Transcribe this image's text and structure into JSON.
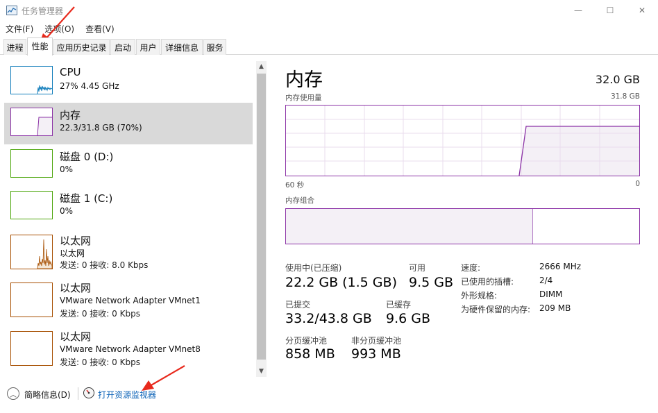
{
  "window": {
    "title": "任务管理器",
    "minimize_glyph": "—",
    "maximize_glyph": "☐",
    "close_glyph": "✕"
  },
  "menu": [
    "文件(F)",
    "选项(O)",
    "查看(V)"
  ],
  "tabs": [
    "进程",
    "性能",
    "应用历史记录",
    "启动",
    "用户",
    "详细信息",
    "服务"
  ],
  "active_tab": "性能",
  "sidebar": {
    "items": [
      {
        "title": "CPU",
        "line1": "27%  4.45 GHz",
        "line2": "",
        "color": "#117dbb"
      },
      {
        "title": "内存",
        "line1": "22.3/31.8 GB (70%)",
        "line2": "",
        "color": "#8b32a6"
      },
      {
        "title": "磁盘 0 (D:)",
        "line1": "0%",
        "line2": "",
        "color": "#4da60c"
      },
      {
        "title": "磁盘 1 (C:)",
        "line1": "0%",
        "line2": "",
        "color": "#4da60c"
      },
      {
        "title": "以太网",
        "line1": "以太网",
        "line2": "发送: 0  接收: 8.0 Kbps",
        "color": "#a74f01"
      },
      {
        "title": "以太网",
        "line1": "VMware Network Adapter VMnet1",
        "line2": "发送: 0  接收: 0 Kbps",
        "color": "#a74f01"
      },
      {
        "title": "以太网",
        "line1": "VMware Network Adapter VMnet8",
        "line2": "发送: 0  接收: 0 Kbps",
        "color": "#a74f01"
      }
    ],
    "selected": "内存",
    "scroll_up_glyph": "▲",
    "scroll_down_glyph": "▼"
  },
  "memory": {
    "title": "内存",
    "total": "32.0 GB",
    "usage_label": "内存使用量",
    "usage_max": "31.8 GB",
    "axis_left": "60 秒",
    "axis_right": "0",
    "composition_label": "内存组合",
    "composition_used_fraction": 0.7,
    "stats": {
      "in_use_label": "使用中(已压缩)",
      "in_use_value": "22.2 GB (1.5 GB)",
      "available_label": "可用",
      "available_value": "9.5 GB",
      "committed_label": "已提交",
      "committed_value": "33.2/43.8 GB",
      "cached_label": "已缓存",
      "cached_value": "9.6 GB",
      "paged_label": "分页缓冲池",
      "paged_value": "858 MB",
      "nonpaged_label": "非分页缓冲池",
      "nonpaged_value": "993 MB"
    },
    "properties": [
      {
        "key": "速度:",
        "value": "2666 MHz"
      },
      {
        "key": "已使用的插槽:",
        "value": "2/4"
      },
      {
        "key": "外形规格:",
        "value": "DIMM"
      },
      {
        "key": "为硬件保留的内存:",
        "value": "209 MB"
      }
    ],
    "graph_color": "#8b32a6"
  },
  "footer": {
    "fewer_details": "简略信息(D)",
    "fewer_glyph": "︿",
    "open_resource_monitor": "打开资源监视器"
  },
  "annotation_color": "#e8291c"
}
